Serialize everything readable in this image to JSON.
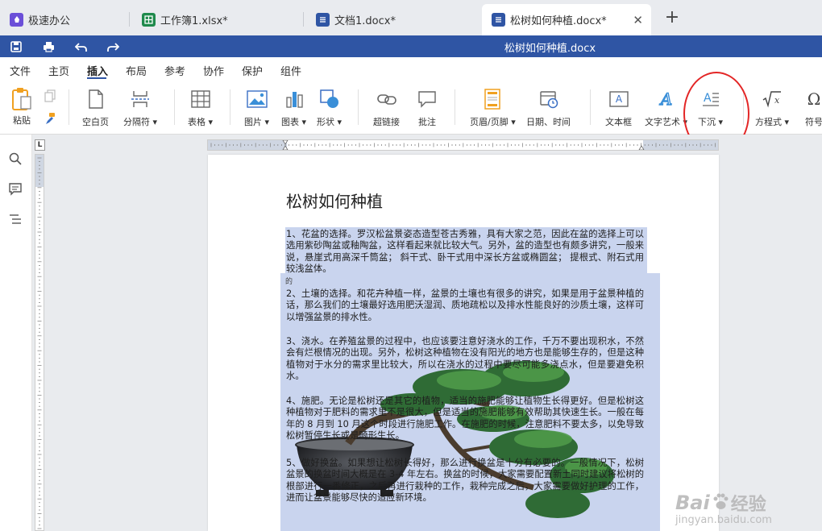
{
  "tabs": [
    {
      "label": "极速办公",
      "icon": "app-rocket-icon",
      "color": "#6b4fd8"
    },
    {
      "label": "工作簿1.xlsx*",
      "icon": "spreadsheet-icon",
      "color": "#1f8a4c"
    },
    {
      "label": "文档1.docx*",
      "icon": "document-icon",
      "color": "#2f55a4"
    },
    {
      "label": "松树如何种植.docx*",
      "icon": "document-icon",
      "color": "#2f55a4",
      "active": true
    }
  ],
  "window": {
    "title": "松树如何种植.docx"
  },
  "menu": [
    "文件",
    "主页",
    "插入",
    "布局",
    "参考",
    "协作",
    "保护",
    "组件"
  ],
  "menu_active": "插入",
  "ribbon": {
    "paste": "粘贴",
    "blank_page": "空白页",
    "separator": "分隔符",
    "table": "表格",
    "picture": "图片",
    "chart": "图表",
    "shape": "形状",
    "hyperlink": "超链接",
    "comment": "批注",
    "header_footer": "页眉/页脚",
    "date_time": "日期、时间",
    "textbox": "文本框",
    "text_art": "文字艺术",
    "drop_cap": "下沉",
    "equation": "方程式",
    "symbol": "符号"
  },
  "document": {
    "title": "松树如何种植",
    "stray_char": "的",
    "paragraphs": [
      "1、花盆的选择。罗汉松盆景姿态造型苍古秀雅，具有大家之范，因此在盆的选择上可以选用紫砂陶盆或釉陶盆，这样看起来就比较大气。另外，盆的造型也有颇多讲究，一般来说，悬崖式用高深千筒盆；  斜干式、卧干式用中深长方盆或椭圆盆；  提根式、附石式用较浅盆体。",
      "2、土壤的选择。和花卉种植一样，盆景的土壤也有很多的讲究，如果是用于盆景种植的话，那么我们的土壤最好选用肥沃湿润、质地疏松以及排水性能良好的沙质土壤，这样可以增强盆景的排水性。",
      "3、浇水。在养殖盆景的过程中，也应该要注意好浇水的工作，千万不要出现积水，不然会有烂根情况的出现。另外，松树这种植物在没有阳光的地方也是能够生存的，但是这种植物对于水分的需求里比较大，所以在浇水的过程中要尽可能多浇点水，但是要避免积水。",
      "4、施肥。无论是松树还是其它的植物，适当的施肥能够让植物生长得更好。但是松树这种植物对于肥料的需求里不是很大，但是适当的施肥能够有效帮助其快速生长。一般在每年的 8 月到 10 月这个时段进行施肥工作。在施肥的时候，注意肥料不要太多，以免导致松树暂停生长或是畸形生长。",
      "5、做好换盆。如果想让松树长得好，那么进行换盆是十分有必要的。一般情况下，松树盆景的换盆时间大概是在 3-4 年左右。换盆的时候，大家需要配置新土同时建议将松树的根部进行一番修正，之后再进行栽种的工作，栽种完成之后，大家需要做好护理的工作，进而让盆景能够尽快的适应新环境。"
    ]
  },
  "watermark": {
    "brand": "Bai",
    "brand_cn": "经验",
    "url": "jingyan.baidu.com"
  }
}
